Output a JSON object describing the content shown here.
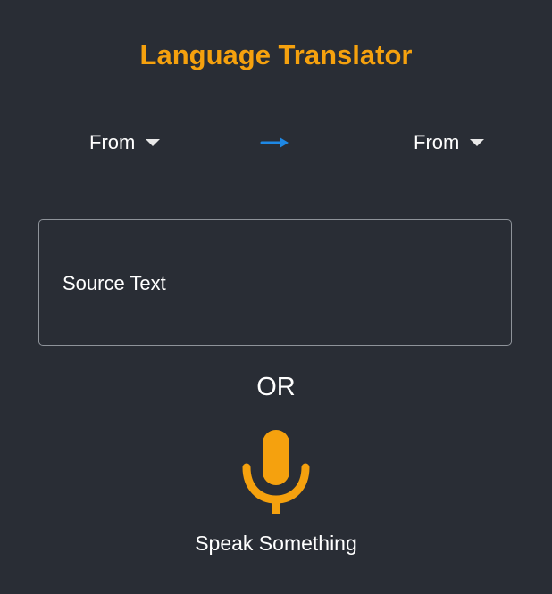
{
  "app": {
    "title": "Language Translator"
  },
  "languages": {
    "source_label": "From",
    "target_label": "From"
  },
  "source": {
    "placeholder": "Source Text"
  },
  "divider": {
    "or_label": "OR"
  },
  "voice": {
    "label": "Speak Something"
  },
  "icons": {
    "swap": "arrow-right-icon",
    "mic": "microphone-icon",
    "dropdown": "caret-down-icon"
  },
  "colors": {
    "background": "#292d35",
    "accent": "#f5a10e",
    "arrow": "#1e88e5",
    "text": "#ffffff",
    "border": "#8e939a"
  }
}
